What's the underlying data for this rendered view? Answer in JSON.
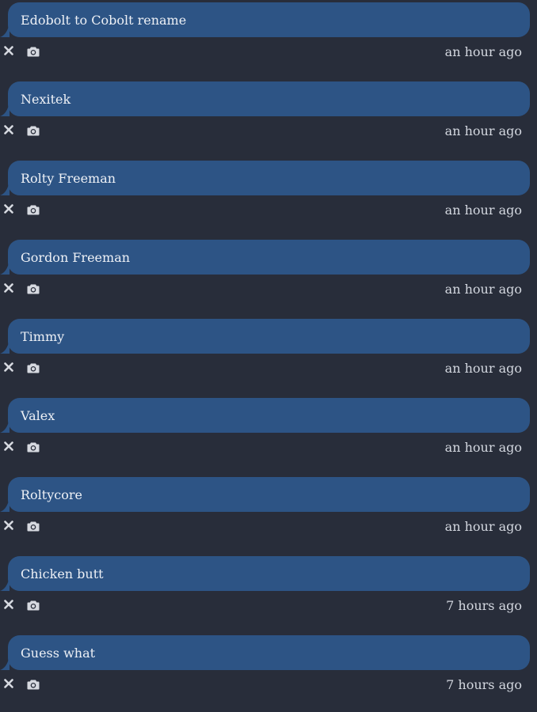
{
  "colors": {
    "background": "#282d3a",
    "bubble": "#2d5485",
    "text": "#eef1f6",
    "icon": "#d6d9e0"
  },
  "icons": {
    "delete": "close-icon",
    "screenshot": "camera-icon"
  },
  "messages": [
    {
      "text": "Edobolt to Cobolt rename",
      "time": "an hour ago"
    },
    {
      "text": "Nexitek",
      "time": "an hour ago"
    },
    {
      "text": "Rolty Freeman",
      "time": "an hour ago"
    },
    {
      "text": "Gordon Freeman",
      "time": "an hour ago"
    },
    {
      "text": "Timmy",
      "time": "an hour ago"
    },
    {
      "text": "Valex",
      "time": "an hour ago"
    },
    {
      "text": "Roltycore",
      "time": "an hour ago"
    },
    {
      "text": "Chicken butt",
      "time": "7 hours ago"
    },
    {
      "text": "Guess what",
      "time": "7 hours ago"
    }
  ]
}
